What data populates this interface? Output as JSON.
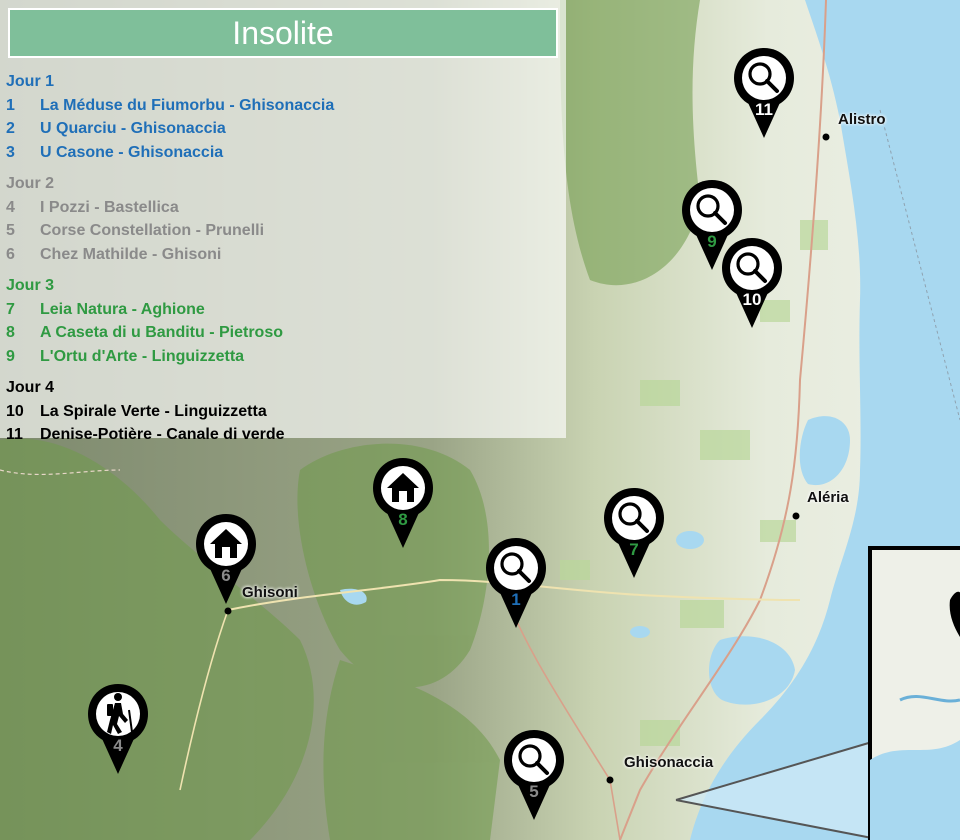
{
  "title": "Insolite",
  "colors": {
    "title_bg": "#7fbf9a",
    "day1": "#1f6fb8",
    "day2": "#8a8a8a",
    "day3": "#2f9a42",
    "day4": "#000000",
    "sea": "#a8d8f0"
  },
  "days": [
    {
      "label": "Jour 1",
      "items": [
        {
          "num": "1",
          "text": "La Méduse du Fiumorbu - Ghisonaccia"
        },
        {
          "num": "2",
          "text": "U Quarciu - Ghisonaccia"
        },
        {
          "num": "3",
          "text": "U Casone - Ghisonaccia"
        }
      ]
    },
    {
      "label": "Jour 2",
      "items": [
        {
          "num": "4",
          "text": "I Pozzi - Bastellica"
        },
        {
          "num": "5",
          "text": "Corse Constellation - Prunelli"
        },
        {
          "num": "6",
          "text": "Chez Mathilde - Ghisoni"
        }
      ]
    },
    {
      "label": "Jour 3",
      "items": [
        {
          "num": "7",
          "text": "Leia Natura - Aghione"
        },
        {
          "num": "8",
          "text": "A Caseta di u Banditu - Pietroso"
        },
        {
          "num": "9",
          "text": "L'Ortu d'Arte - Linguizzetta"
        }
      ]
    },
    {
      "label": "Jour 4",
      "items": [
        {
          "num": "10",
          "text": "La Spirale Verte - Linguizzetta"
        },
        {
          "num": "11",
          "text": "Denise-Potière - Canale di verde"
        }
      ]
    }
  ],
  "places": {
    "alistro": "Alistro",
    "aleria": "Aléria",
    "ghisoni": "Ghisoni",
    "ghisonaccia": "Ghisonaccia"
  },
  "markers": {
    "m1": {
      "label": "1",
      "icon": "magnifier-icon"
    },
    "m4": {
      "label": "4",
      "icon": "hiker-icon"
    },
    "m5": {
      "label": "5",
      "icon": "magnifier-icon"
    },
    "m6": {
      "label": "6",
      "icon": "house-icon"
    },
    "m7": {
      "label": "7",
      "icon": "magnifier-icon"
    },
    "m8": {
      "label": "8",
      "icon": "house-icon"
    },
    "m9": {
      "label": "9",
      "icon": "magnifier-icon"
    },
    "m10": {
      "label": "10",
      "icon": "magnifier-icon"
    },
    "m11": {
      "label": "11",
      "icon": "magnifier-icon"
    }
  }
}
